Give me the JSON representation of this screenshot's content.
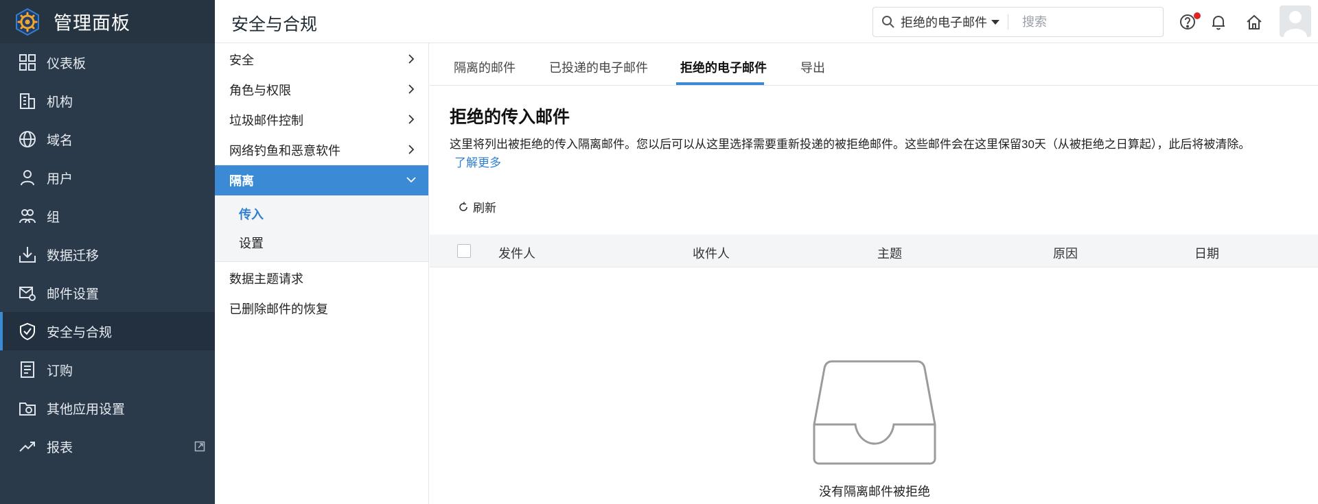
{
  "app": {
    "title": "管理面板"
  },
  "header": {
    "page_title": "安全与合规",
    "search_scope": "拒绝的电子邮件",
    "search_placeholder": "搜索"
  },
  "sidebar": {
    "items": [
      {
        "label": "仪表板",
        "icon": "dashboard-icon"
      },
      {
        "label": "机构",
        "icon": "building-icon"
      },
      {
        "label": "域名",
        "icon": "globe-icon"
      },
      {
        "label": "用户",
        "icon": "user-icon"
      },
      {
        "label": "组",
        "icon": "group-icon"
      },
      {
        "label": "数据迁移",
        "icon": "download-tray-icon"
      },
      {
        "label": "邮件设置",
        "icon": "mail-gear-icon"
      },
      {
        "label": "安全与合规",
        "icon": "shield-check-icon",
        "active": true
      },
      {
        "label": "订购",
        "icon": "subscription-icon"
      },
      {
        "label": "其他应用设置",
        "icon": "folder-gear-icon"
      },
      {
        "label": "报表",
        "icon": "trend-up-icon"
      }
    ]
  },
  "submenu": {
    "items": [
      "安全",
      "角色与权限",
      "垃圾邮件控制",
      "网络钓鱼和恶意软件"
    ],
    "open_item": "隔离",
    "children": [
      "传入",
      "设置"
    ],
    "after_items": [
      "数据主题请求",
      "已删除邮件的恢复"
    ]
  },
  "tabs": [
    "隔离的邮件",
    "已投递的电子邮件",
    "拒绝的电子邮件",
    "导出"
  ],
  "active_tab": "拒绝的电子邮件",
  "content": {
    "title": "拒绝的传入邮件",
    "description": "这里将列出被拒绝的传入隔离邮件。您以后可以从这里选择需要重新投递的被拒绝邮件。这些邮件会在这里保留30天（从被拒绝之日算起），此后将被清除。",
    "learn_more": "了解更多",
    "refresh_label": "刷新",
    "columns": [
      "发件人",
      "收件人",
      "主题",
      "原因",
      "日期"
    ],
    "empty_text": "没有隔离邮件被拒绝"
  },
  "colors": {
    "sidebar_bg": "#2b3a4a",
    "accent": "#3a8ad4",
    "notification_dot": "#e02424"
  }
}
